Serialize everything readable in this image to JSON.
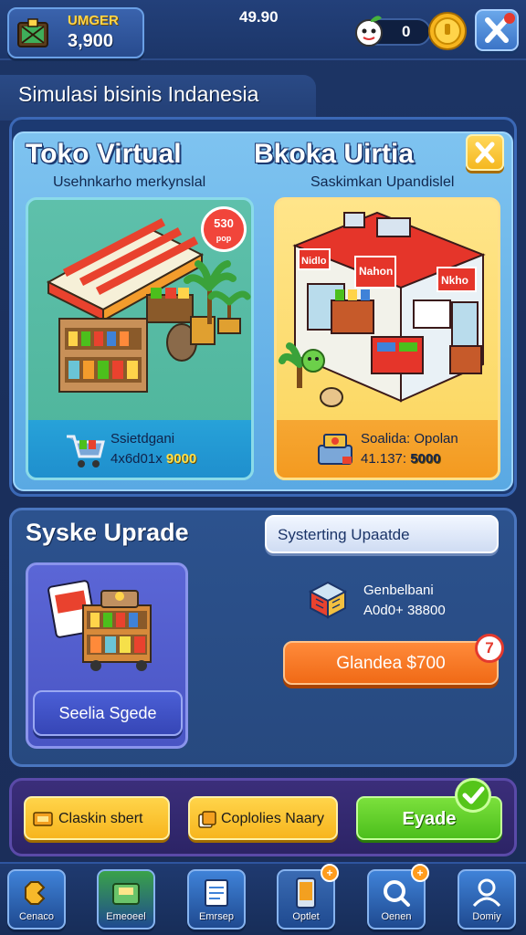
{
  "wallet": {
    "label": "UMGER",
    "value": "3,900",
    "icon": "treasure-crate-icon"
  },
  "status": {
    "time": "49.90",
    "gems": "0"
  },
  "title": "Simulasi bisinis Indanesia",
  "store_panel": {
    "left_title": "Toko Virtual",
    "left_subtitle": "Usehnkarho merkynslal",
    "right_title": "Bkoka Uirtia",
    "right_subtitle": "Saskimkan Upandislel",
    "badge_top": "530",
    "badge_bottom": "pop",
    "card_a": {
      "label": "Ssietdgani",
      "price_prefix": "4x6d01x",
      "price_value": "9000",
      "icon": "shopping-cart-icon"
    },
    "card_b": {
      "label": "Soalida: Opolan",
      "price_prefix": "41.137:",
      "price_value": "5000",
      "icon": "cash-register-icon"
    },
    "shop_sign_a": "Nidlo",
    "shop_sign_b": "Nahon",
    "shop_sign_c": "Nkho"
  },
  "upgrade_panel": {
    "title": "Syske Uprade",
    "field": "Systerting Upaatde",
    "card_button": "Seelia Sgede",
    "info_label": "Genbelbani",
    "info_value": "A0d0+ 38800",
    "upgrade_button": "Glandea $700",
    "upgrade_badge": "7"
  },
  "actions": {
    "btn1": "Claskin sbert",
    "btn2": "Coplolies Naary",
    "btn3": "Eyade"
  },
  "nav": [
    {
      "label": "Cenaco",
      "icon": "puzzle-icon",
      "color": "#3f82d8"
    },
    {
      "label": "Emeoeel",
      "icon": "cash-box-icon",
      "color": "#3aa24a"
    },
    {
      "label": "Emrsep",
      "icon": "document-stack-icon",
      "color": "#3f82d8"
    },
    {
      "label": "Optlet",
      "icon": "phone-icon",
      "color": "#3a6bb3",
      "badge": "+"
    },
    {
      "label": "Oenen",
      "icon": "search-icon",
      "color": "#3f82d8",
      "badge": "+"
    },
    {
      "label": "Domiy",
      "icon": "person-icon",
      "color": "#3f82d8"
    }
  ],
  "colors": {
    "accent_yellow": "#ffd44a",
    "accent_orange": "#f06a16",
    "accent_green": "#4cbf1c",
    "panel_blue": "#27497f"
  }
}
